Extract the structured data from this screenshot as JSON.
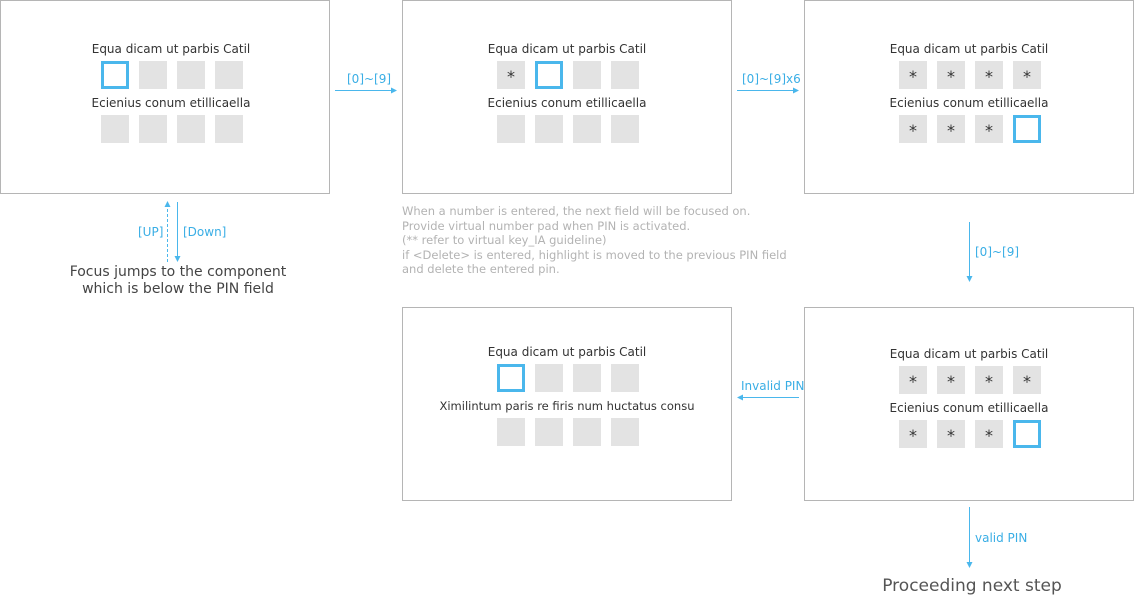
{
  "screens": [
    {
      "label1": "Equa dicam ut parbis Catil",
      "label2": "Ecienius conum etillicaella",
      "row1": [
        "",
        "",
        "",
        ""
      ],
      "row2": [
        "",
        "",
        "",
        ""
      ]
    },
    {
      "label1": "Equa dicam ut parbis Catil",
      "label2": "Ecienius conum etillicaella",
      "row1": [
        "*",
        "",
        "",
        ""
      ],
      "row2": [
        "",
        "",
        "",
        ""
      ]
    },
    {
      "label1": "Equa dicam ut parbis Catil",
      "label2": "Ecienius conum etillicaella",
      "row1": [
        "*",
        "*",
        "*",
        "*"
      ],
      "row2": [
        "*",
        "*",
        "*",
        ""
      ]
    },
    {
      "label1": "Equa dicam ut parbis Catil",
      "label2": "Ximilintum paris re firis num huctatus consu",
      "row1": [
        "",
        "",
        "",
        ""
      ],
      "row2": [
        "",
        "",
        "",
        ""
      ]
    },
    {
      "label1": "Equa dicam ut parbis Catil",
      "label2": "Ecienius conum etillicaella",
      "row1": [
        "*",
        "*",
        "*",
        "*"
      ],
      "row2": [
        "*",
        "*",
        "*",
        ""
      ]
    }
  ],
  "arrows": {
    "key_0_9_a": "[0]~[9]",
    "key_0_9_x6": "[0]~[9]x6",
    "key_0_9_b": "[0]~[9]",
    "invalid_pin": "Invalid PIN",
    "valid_pin": "valid PIN",
    "up": "[UP]",
    "down": "[Down]"
  },
  "focus_caption": [
    "Focus jumps to the component",
    "which is below the PIN field"
  ],
  "note_lines": [
    "When a number is entered, the next field will be focused on.",
    "Provide virtual number pad when PIN is activated.",
    "(** refer to virtual key_IA guideline)",
    "if <Delete> is entered, highlight is moved to the previous PIN field",
    "and delete the entered pin."
  ],
  "final_step": "Proceeding next step",
  "colors": {
    "accent": "#4ab7ec",
    "cell": "#e3e3e3",
    "border": "#b5b5b5",
    "note": "#b3b3b3"
  }
}
